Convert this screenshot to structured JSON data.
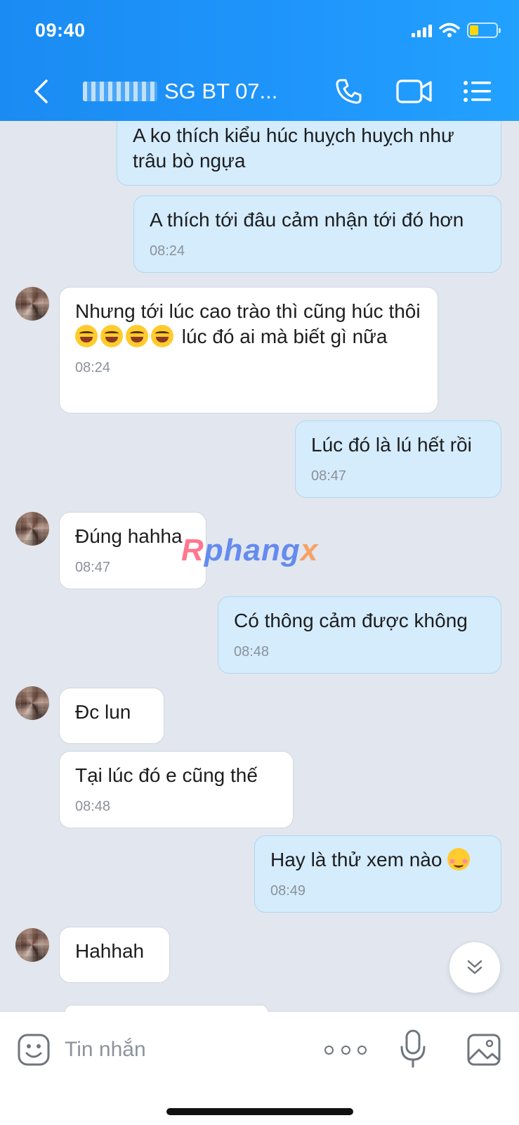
{
  "status_bar": {
    "time": "09:40"
  },
  "header": {
    "title": "SG BT 07..."
  },
  "messages": [
    {
      "direction": "out",
      "text": "A ko thích kiểu húc huỵch huỵch như trâu bò ngựa",
      "time": ""
    },
    {
      "direction": "out",
      "text": "A thích tới đâu cảm nhận tới đó hơn",
      "time": "08:24"
    },
    {
      "direction": "in",
      "text_before": "Nhưng tới lúc cao trào thì cũng húc thôi",
      "emoji_count": 4,
      "text_after": "lúc đó ai mà biết gì nữa",
      "time": "08:24"
    },
    {
      "direction": "out",
      "text": "Lúc đó là lú hết rồi",
      "time": "08:47"
    },
    {
      "direction": "in",
      "text": "Đúng hahha",
      "time": "08:47"
    },
    {
      "direction": "out",
      "text": "Có thông cảm được không",
      "time": "08:48"
    },
    {
      "direction": "in",
      "text": "Đc lun",
      "time": ""
    },
    {
      "direction": "in",
      "text": "Tại lúc đó e cũng thế",
      "time": "08:48"
    },
    {
      "direction": "out",
      "text": "Hay là thử xem nào",
      "emoji": "smiling-blush",
      "time": "08:49"
    },
    {
      "direction": "in",
      "text": "Hahhah",
      "time": ""
    }
  ],
  "watermark": {
    "part1": "R",
    "part2": "phang",
    "part3": "x"
  },
  "composer": {
    "placeholder": "Tin nhắn"
  },
  "colors": {
    "header_bg": "#1f96fb",
    "outgoing_bubble": "#d4ecfc",
    "incoming_bubble": "#ffffff",
    "chat_bg": "#e2e6ee"
  },
  "icons": [
    "back-icon",
    "phone-icon",
    "video-icon",
    "menu-icon",
    "chevron-double-down-icon",
    "sticker-icon",
    "more-icon",
    "microphone-icon",
    "image-icon"
  ]
}
